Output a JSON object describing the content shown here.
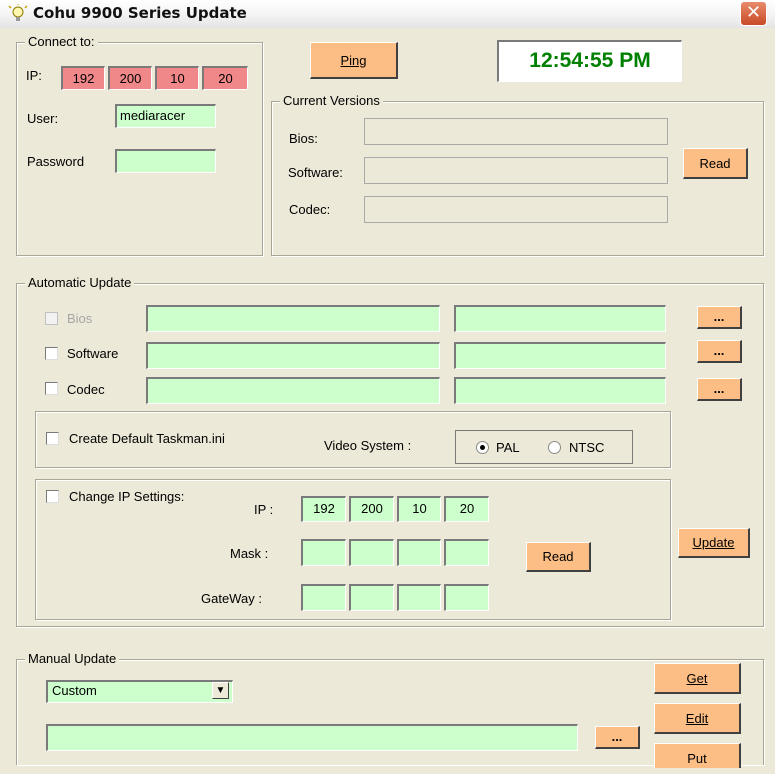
{
  "window": {
    "title": "Cohu 9900 Series Update",
    "close_glyph": "✕"
  },
  "clock": "12:54:55 PM",
  "connect": {
    "legend": "Connect to:",
    "ip_label": "IP:",
    "ip": [
      "192",
      "200",
      "10",
      "20"
    ],
    "user_label": "User:",
    "user_value": "mediaracer",
    "password_label": "Password",
    "password_value": ""
  },
  "ping_button": "Ping",
  "versions": {
    "legend": "Current Versions",
    "bios_label": "Bios:",
    "software_label": "Software:",
    "codec_label": "Codec:",
    "bios_value": "",
    "software_value": "",
    "codec_value": "",
    "read_button": "Read"
  },
  "auto_update": {
    "legend": "Automatic Update",
    "bios_label": "Bios",
    "software_label": "Software",
    "codec_label": "Codec",
    "browse_label": "...",
    "create_default_label": "Create Default Taskman.ini",
    "video_system_label": "Video System :",
    "pal_label": "PAL",
    "ntsc_label": "NTSC",
    "video_selected": "PAL",
    "change_ip_label": "Change IP Settings:",
    "ip_label": "IP :",
    "ip": [
      "192",
      "200",
      "10",
      "20"
    ],
    "mask_label": "Mask :",
    "gateway_label": "GateWay :",
    "read_button": "Read",
    "update_button": "Update"
  },
  "manual_update": {
    "legend": "Manual Update",
    "select_value": "Custom",
    "file_value": "",
    "browse_label": "...",
    "get_button": "Get",
    "edit_button": "Edit",
    "put_button": "Put"
  },
  "colors": {
    "field": "#ccffcc",
    "ip_field": "#f0888a",
    "button": "#fcbe85",
    "clock_text": "#008000"
  }
}
